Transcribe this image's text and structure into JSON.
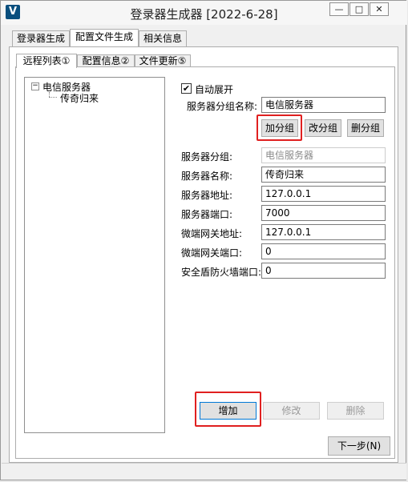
{
  "window": {
    "title": "登录器生成器 [2022-6-28]",
    "app_icon": "V",
    "buttons": {
      "minimize": "—",
      "maximize": "□",
      "close": "✕"
    }
  },
  "top_tabs": [
    "登录器生成",
    "配置文件生成",
    "相关信息"
  ],
  "sub_tabs": [
    "远程列表①",
    "配置信息②",
    "文件更新⑤"
  ],
  "tree": {
    "root": "电信服务器",
    "child": "传奇归来",
    "expander": "−"
  },
  "form": {
    "auto_expand_label": "自动展开",
    "auto_expand_checked": "✔",
    "group_name_label": "服务器分组名称:",
    "group_name_value": "电信服务器",
    "add_group": "加分组",
    "edit_group": "改分组",
    "delete_group": "删分组",
    "group_label": "服务器分组:",
    "group_value": "电信服务器",
    "name_label": "服务器名称:",
    "name_value": "传奇归来",
    "address_label": "服务器地址:",
    "address_value": "127.0.0.1",
    "port_label": "服务器端口:",
    "port_value": "7000",
    "gateway_address_label": "微端网关地址:",
    "gateway_address_value": "127.0.0.1",
    "gateway_port_label": "微端网关端口:",
    "gateway_port_value": "0",
    "firewall_port_label": "安全盾防火墙端口:",
    "firewall_port_value": "0"
  },
  "actions": {
    "add": "增加",
    "edit": "修改",
    "delete": "删除",
    "next": "下一步(N)"
  },
  "colors": {
    "highlight": "#e02020",
    "app_icon": "#0a4f7e"
  }
}
